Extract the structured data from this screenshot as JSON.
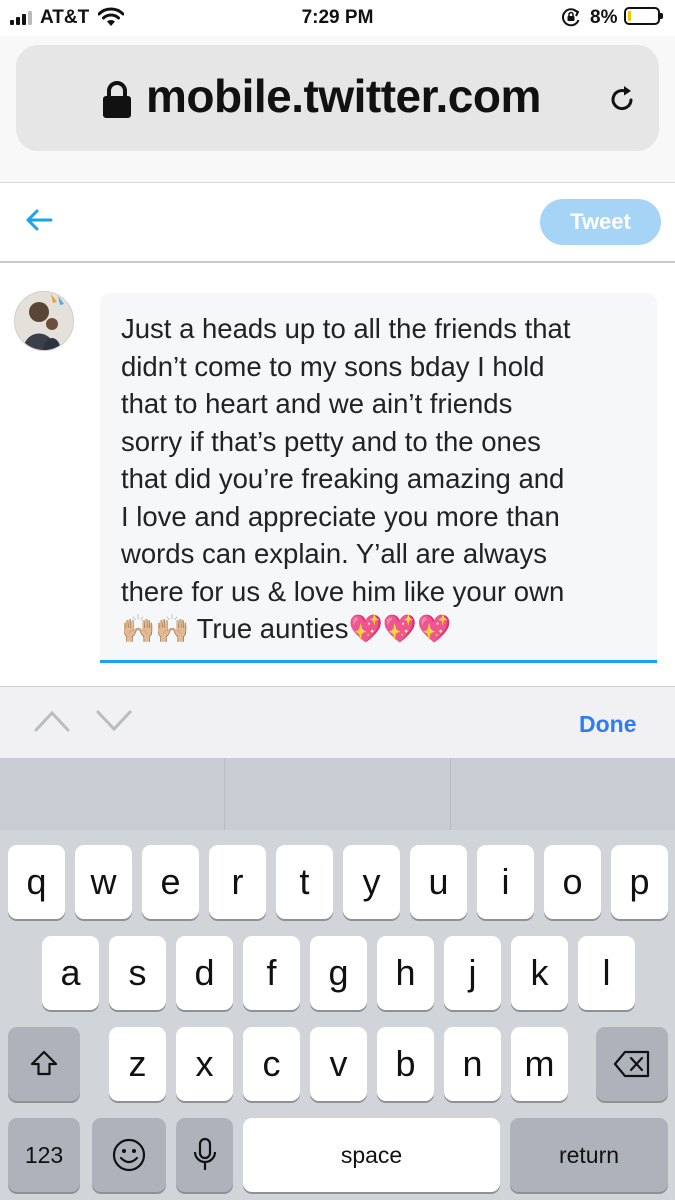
{
  "status_bar": {
    "carrier": "AT&T",
    "time": "7:29 PM",
    "battery_percent": "8%",
    "battery_level": 0.08,
    "icons": [
      "signal-icon",
      "wifi-icon",
      "rotation-lock-icon",
      "battery-icon"
    ]
  },
  "browser": {
    "url": "mobile.twitter.com",
    "icons": [
      "lock-icon",
      "reload-icon"
    ]
  },
  "compose": {
    "tweet_button": "Tweet",
    "text": "Just a heads up to all the friends that\ndidn’t come to my sons bday I hold\nthat to heart and we ain’t friends\nsorry if that’s petty and to the ones\nthat did you’re freaking amazing and\nI love and appreciate you more than\nwords can explain. Y’all are always\nthere for us & love him like your own\n🙌🏼🙌🏼 True aunties💖💖💖",
    "accent_color": "#1da1f2",
    "tweet_button_color": "#a6d4f6"
  },
  "accessory_bar": {
    "done_label": "Done",
    "icons": [
      "chevron-up-icon",
      "chevron-down-icon"
    ]
  },
  "keyboard": {
    "row1": [
      "q",
      "w",
      "e",
      "r",
      "t",
      "y",
      "u",
      "i",
      "o",
      "p"
    ],
    "row2": [
      "a",
      "s",
      "d",
      "f",
      "g",
      "h",
      "j",
      "k",
      "l"
    ],
    "row3": [
      "z",
      "x",
      "c",
      "v",
      "b",
      "n",
      "m"
    ],
    "numbers_label": "123",
    "space_label": "space",
    "return_label": "return",
    "icons": [
      "shift-icon",
      "delete-icon",
      "emoji-icon",
      "microphone-icon"
    ]
  }
}
